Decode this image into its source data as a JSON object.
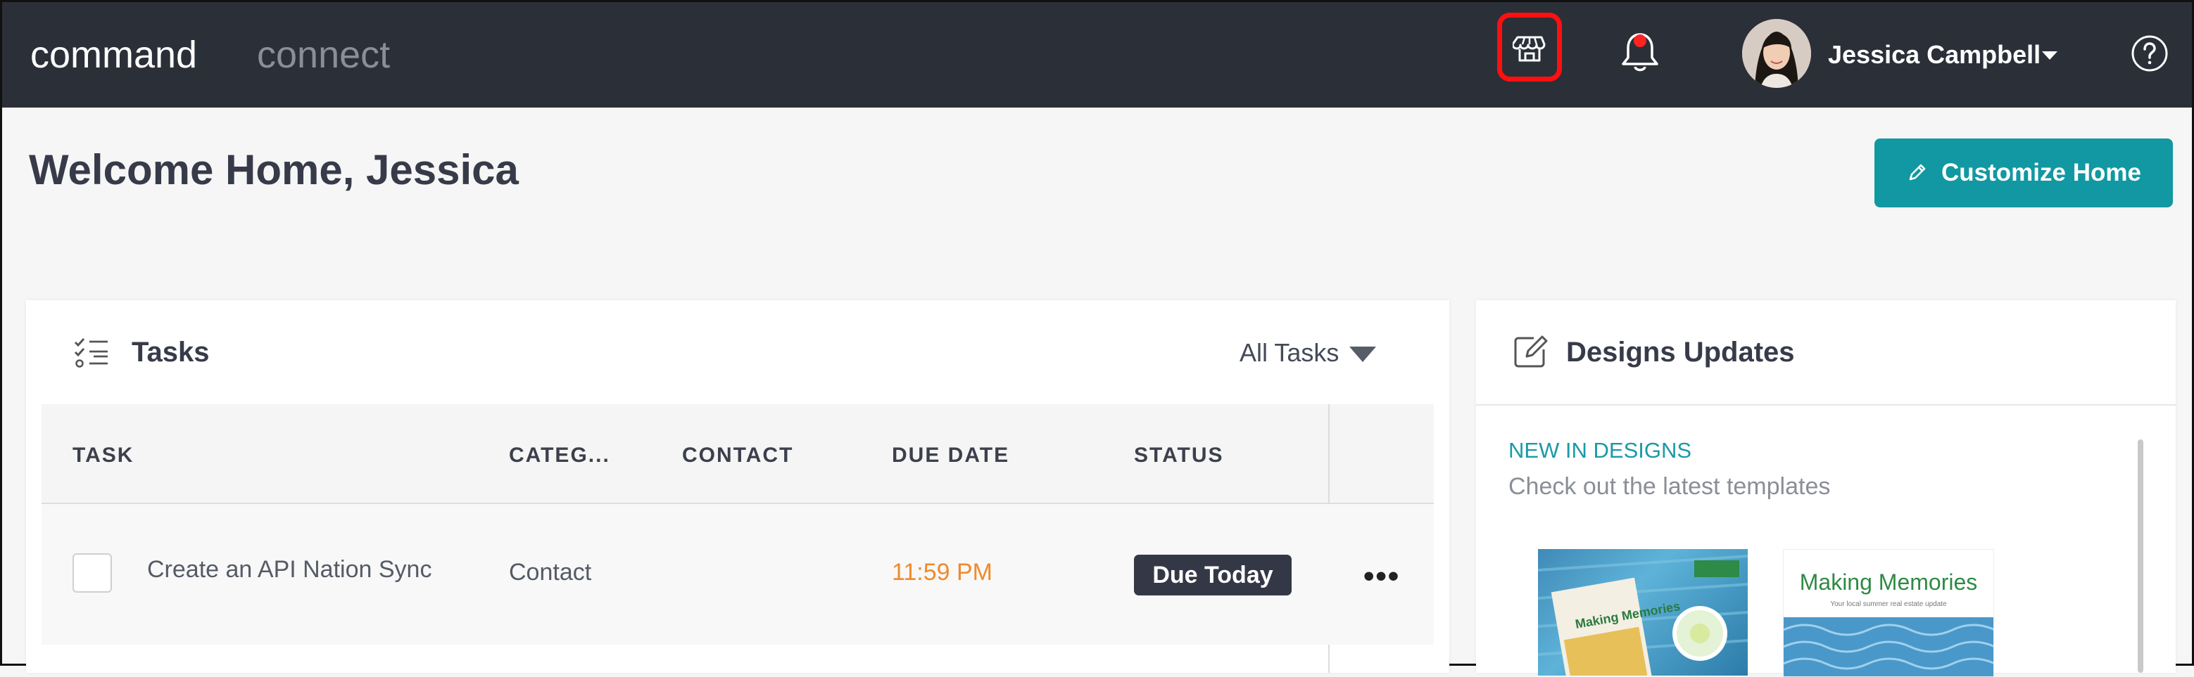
{
  "header": {
    "brand_primary": "command",
    "brand_secondary": "connect",
    "user_name": "Jessica Campbell",
    "icons": [
      "storefront-icon",
      "bell-icon",
      "notification-dot",
      "avatar",
      "chevron-down-icon",
      "help-icon"
    ]
  },
  "page": {
    "title": "Welcome Home, Jessica",
    "customize_label": "Customize Home"
  },
  "tasks": {
    "title": "Tasks",
    "filter_label": "All Tasks",
    "columns": [
      "TASK",
      "CATEG...",
      "CONTACT",
      "DUE DATE",
      "STATUS"
    ],
    "rows": [
      {
        "task": "Create an API Nation Sync",
        "category": "Contact",
        "contact": "",
        "due": "11:59 PM",
        "status": "Due Today"
      }
    ]
  },
  "designs": {
    "title": "Designs Updates",
    "new_label": "NEW IN DESIGNS",
    "new_sub": "Check out the latest templates",
    "thumb2_title": "Making Memories",
    "thumb2_subtitle": "Your local summer real estate update",
    "thumb1_title": "Making Memories"
  },
  "colors": {
    "topbar": "#2b2f38",
    "accent": "#1198a2",
    "highlight": "#ff1010",
    "due_time": "#f08a2c"
  }
}
